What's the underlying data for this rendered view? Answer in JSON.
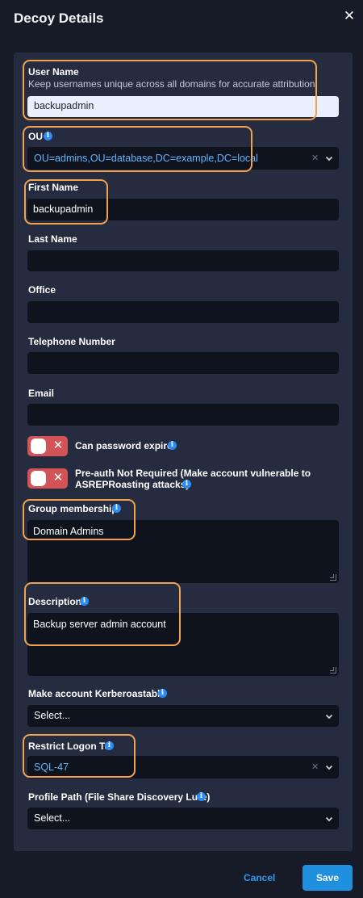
{
  "dialog": {
    "title": "Decoy Details",
    "close_icon": "close-icon"
  },
  "form": {
    "user_name": {
      "label": "User Name",
      "help": "Keep usernames unique across all domains for accurate attribution",
      "value": "backupadmin"
    },
    "ou": {
      "label": "OU",
      "value": "OU=admins,OU=database,DC=example,DC=local"
    },
    "first_name": {
      "label": "First Name",
      "value": "backupadmin"
    },
    "last_name": {
      "label": "Last Name",
      "value": ""
    },
    "office": {
      "label": "Office",
      "value": ""
    },
    "telephone": {
      "label": "Telephone Number",
      "value": ""
    },
    "email": {
      "label": "Email",
      "value": ""
    },
    "password_expire": {
      "label": "Can password expire",
      "checked": false
    },
    "preauth": {
      "label_line1": "Pre-auth Not Required (Make account vulnerable to",
      "label_line2": "ASREPRoasting attacks)",
      "checked": false
    },
    "group_membership": {
      "label": "Group membership",
      "value": "Domain Admins"
    },
    "description": {
      "label": "Description",
      "value": "Backup server admin account"
    },
    "kerberoastable": {
      "label": "Make account Kerberoastable",
      "value": "Select..."
    },
    "restrict_logon": {
      "label": "Restrict Logon To",
      "value": "SQL-47"
    },
    "profile_path": {
      "label": "Profile Path (File Share Discovery Lure)",
      "value": "Select..."
    }
  },
  "footer": {
    "cancel_label": "Cancel",
    "save_label": "Save"
  },
  "colors": {
    "background": "#161b27",
    "panel": "#252c3f",
    "field": "#0f131d",
    "highlight": "#f2a24f",
    "toggle_off": "#d45356",
    "accent": "#1f8fe0",
    "link": "#2f9cf0"
  }
}
